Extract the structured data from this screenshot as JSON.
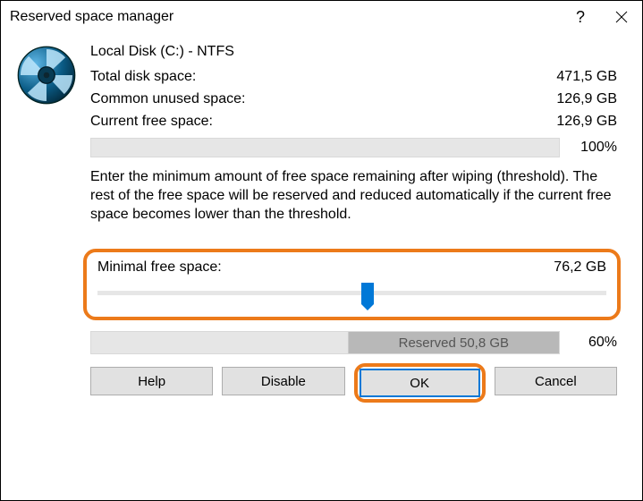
{
  "titlebar": {
    "title": "Reserved space manager",
    "help_icon": "?",
    "close_icon": "×"
  },
  "disk": {
    "label": "Local Disk (C:) - NTFS"
  },
  "stats": {
    "total_label": "Total disk space:",
    "total_value": "471,5 GB",
    "unused_label": "Common unused space:",
    "unused_value": "126,9 GB",
    "free_label": "Current free space:",
    "free_value": "126,9 GB",
    "free_pct": "100%"
  },
  "description": "Enter the minimum amount of free space remaining after wiping (threshold). The rest of the free space will be reserved and reduced automatically if the current free space becomes lower than the threshold.",
  "slider": {
    "label": "Minimal free space:",
    "value": "76,2 GB",
    "position_pct": 53
  },
  "reserved": {
    "label": "Reserved 50,8 GB",
    "pct": "60%",
    "fill_pct": 45
  },
  "buttons": {
    "help": "Help",
    "disable": "Disable",
    "ok": "OK",
    "cancel": "Cancel"
  }
}
